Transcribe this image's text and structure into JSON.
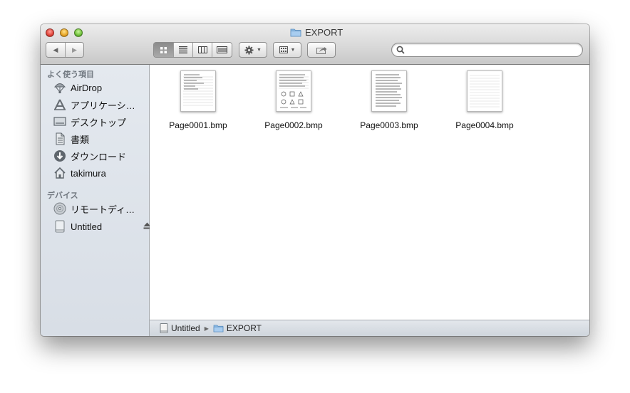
{
  "window": {
    "title": "EXPORT"
  },
  "toolbar": {
    "back_glyph": "◀",
    "forward_glyph": "▶",
    "view_modes": [
      "icon-view",
      "list-view",
      "column-view",
      "cover-flow-view"
    ],
    "active_view": "icon-view",
    "search": {
      "value": "",
      "placeholder": ""
    }
  },
  "sidebar": {
    "favorites_header": "よく使う項目",
    "favorites": [
      {
        "label": "AirDrop",
        "icon": "airdrop-icon"
      },
      {
        "label": "アプリケーシ…",
        "icon": "applications-icon"
      },
      {
        "label": "デスクトップ",
        "icon": "desktop-icon"
      },
      {
        "label": "書類",
        "icon": "documents-icon"
      },
      {
        "label": "ダウンロード",
        "icon": "downloads-icon"
      },
      {
        "label": "takimura",
        "icon": "home-icon"
      }
    ],
    "devices_header": "デバイス",
    "devices": [
      {
        "label": "リモートディ…",
        "icon": "remote-disc-icon"
      },
      {
        "label": "Untitled",
        "icon": "drive-icon",
        "ejectable": true
      }
    ]
  },
  "files": [
    {
      "name": "Page0001.bmp"
    },
    {
      "name": "Page0002.bmp"
    },
    {
      "name": "Page0003.bmp"
    },
    {
      "name": "Page0004.bmp"
    }
  ],
  "pathbar": {
    "items": [
      {
        "label": "Untitled",
        "icon": "drive-icon"
      },
      {
        "label": "EXPORT",
        "icon": "folder-icon"
      }
    ]
  }
}
